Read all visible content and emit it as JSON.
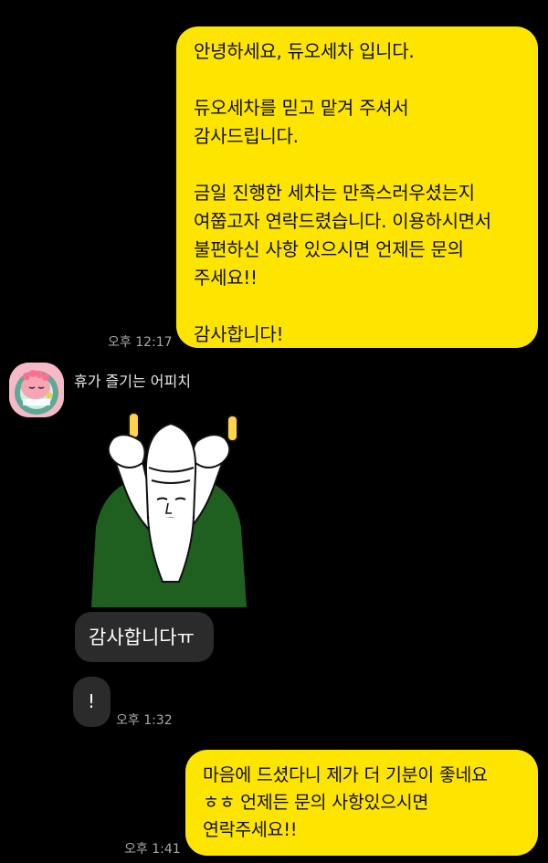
{
  "messages": {
    "first_outgoing": {
      "text": "안녕하세요, 듀오세차 입니다.\n\n듀오세차를 믿고 맡겨 주셔서\n감사드립니다.\n\n금일 진행한 세차는 만족스러우셨는지\n여쭙고자 연락드렸습니다. 이용하시면서\n불편하신 사항 있으시면 언제든 문의\n주세요!!\n\n감사합니다!",
      "time": "오후 12:17"
    },
    "incoming": {
      "sender_name": "휴가 즐기는 어피치",
      "sticker_icon": "thumbs-up-sticker",
      "bubble_1": "감사합니다ㅠ",
      "bubble_2": "!",
      "time": "오후 1:32"
    },
    "last_outgoing": {
      "text": "마음에 드셨다니 제가 더 기분이 좋네요\nㅎㅎ 언제든 문의 사항있으시면\n연락주세요!!",
      "time": "오후 1:41"
    }
  },
  "colors": {
    "background": "#000000",
    "outgoing_bubble": "#FEE500",
    "incoming_bubble": "#2B2B2B",
    "timestamp": "#A7A7A7"
  }
}
